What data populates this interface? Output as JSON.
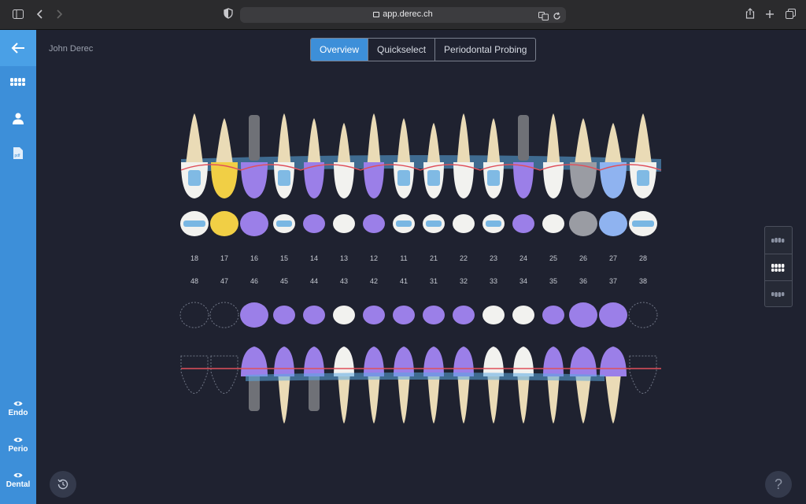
{
  "browser": {
    "url": "app.derec.ch"
  },
  "sidebar": {
    "items": [
      {
        "label": "Endo",
        "icon": "eye-icon"
      },
      {
        "label": "Perio",
        "icon": "eye-icon"
      },
      {
        "label": "Dental",
        "icon": "eye-icon"
      }
    ]
  },
  "patient": {
    "name": "John Derec"
  },
  "tabs": [
    {
      "label": "Overview",
      "active": true
    },
    {
      "label": "Quickselect",
      "active": false
    },
    {
      "label": "Periodontal Probing",
      "active": false
    }
  ],
  "chart": {
    "upper_numbers": [
      "18",
      "17",
      "16",
      "15",
      "14",
      "13",
      "12",
      "11",
      "21",
      "22",
      "23",
      "24",
      "25",
      "26",
      "27",
      "28"
    ],
    "lower_numbers": [
      "48",
      "47",
      "46",
      "45",
      "44",
      "43",
      "42",
      "41",
      "31",
      "32",
      "33",
      "34",
      "35",
      "36",
      "37",
      "38"
    ],
    "upper_status": [
      "filling",
      "yellow",
      "purple",
      "filling",
      "purple",
      "sound",
      "purple",
      "filling",
      "filling",
      "sound",
      "filling",
      "purple",
      "sound",
      "gray",
      "blue",
      "filling"
    ],
    "lower_status": [
      "missing",
      "missing",
      "purple",
      "purple",
      "purple",
      "sound",
      "purple",
      "purple",
      "purple",
      "purple",
      "sound",
      "sound",
      "purple",
      "purple",
      "purple",
      "missing"
    ],
    "colors": {
      "purple": "#9b7fe8",
      "yellow": "#f1cf45",
      "blue": "#5aa7e0",
      "light_blue": "#8fb3f0",
      "gray": "#9a9ca3",
      "tooth": "#f2f2ef",
      "root": "#eadbb6",
      "gum_line": "#e0505a",
      "accent": "#3d8fd9"
    }
  },
  "help": {
    "label": "?"
  }
}
